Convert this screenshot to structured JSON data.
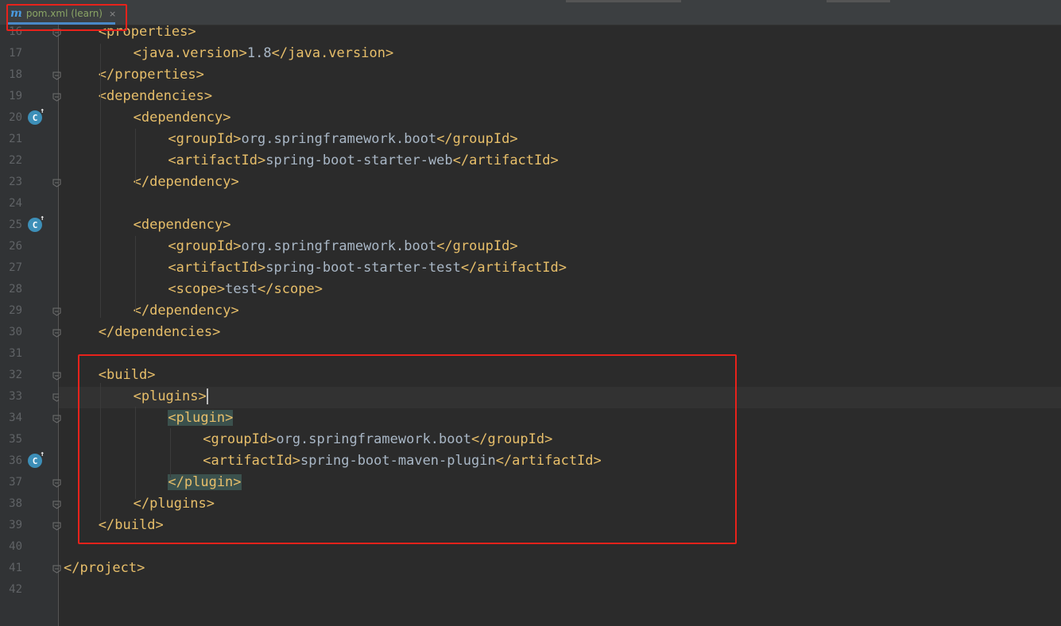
{
  "tab": {
    "icon": "maven-icon",
    "label": "pom.xml (learn)",
    "close_glyph": "×"
  },
  "lines": [
    {
      "n": "16",
      "indent": 1,
      "open": true,
      "tag": "properties"
    },
    {
      "n": "17",
      "indent": 2,
      "open": true,
      "tag": "java.version",
      "text": "1.8",
      "close": "java.version"
    },
    {
      "n": "18",
      "indent": 1,
      "open": false,
      "tag": "properties"
    },
    {
      "n": "19",
      "indent": 1,
      "open": true,
      "tag": "dependencies"
    },
    {
      "n": "20",
      "indent": 2,
      "open": true,
      "tag": "dependency"
    },
    {
      "n": "21",
      "indent": 3,
      "open": true,
      "tag": "groupId",
      "text": "org.springframework.boot",
      "close": "groupId"
    },
    {
      "n": "22",
      "indent": 3,
      "open": true,
      "tag": "artifactId",
      "text": "spring-boot-starter-web",
      "close": "artifactId"
    },
    {
      "n": "23",
      "indent": 2,
      "open": false,
      "tag": "dependency"
    },
    {
      "n": "24",
      "indent": 0,
      "empty": true
    },
    {
      "n": "25",
      "indent": 2,
      "open": true,
      "tag": "dependency"
    },
    {
      "n": "26",
      "indent": 3,
      "open": true,
      "tag": "groupId",
      "text": "org.springframework.boot",
      "close": "groupId"
    },
    {
      "n": "27",
      "indent": 3,
      "open": true,
      "tag": "artifactId",
      "text": "spring-boot-starter-test",
      "close": "artifactId"
    },
    {
      "n": "28",
      "indent": 3,
      "open": true,
      "tag": "scope",
      "text": "test",
      "close": "scope"
    },
    {
      "n": "29",
      "indent": 2,
      "open": false,
      "tag": "dependency"
    },
    {
      "n": "30",
      "indent": 1,
      "open": false,
      "tag": "dependencies"
    },
    {
      "n": "31",
      "indent": 0,
      "empty": true
    },
    {
      "n": "32",
      "indent": 1,
      "open": true,
      "tag": "build"
    },
    {
      "n": "33",
      "indent": 2,
      "open": true,
      "tag": "plugins",
      "caret": true
    },
    {
      "n": "34",
      "indent": 3,
      "open": true,
      "tag": "plugin",
      "highlight": true
    },
    {
      "n": "35",
      "indent": 4,
      "open": true,
      "tag": "groupId",
      "text": "org.springframework.boot",
      "close": "groupId"
    },
    {
      "n": "36",
      "indent": 4,
      "open": true,
      "tag": "artifactId",
      "text": "spring-boot-maven-plugin",
      "close": "artifactId"
    },
    {
      "n": "37",
      "indent": 3,
      "open": false,
      "tag": "plugin",
      "highlight": true
    },
    {
      "n": "38",
      "indent": 2,
      "open": false,
      "tag": "plugins"
    },
    {
      "n": "39",
      "indent": 1,
      "open": false,
      "tag": "build"
    },
    {
      "n": "40",
      "indent": 0,
      "empty": true
    },
    {
      "n": "41",
      "indent": 0,
      "open": false,
      "tag": "project"
    },
    {
      "n": "42",
      "indent": 0,
      "empty": true
    }
  ],
  "gutter_run_icons": [
    "20",
    "25",
    "36"
  ],
  "fold_markers": [
    "16",
    "18",
    "19",
    "23",
    "29",
    "30",
    "32",
    "33",
    "34",
    "37",
    "38",
    "39",
    "41"
  ],
  "colors": {
    "bg": "#2b2b2b",
    "tag": "#e8bf6a",
    "text": "#a9b7c6",
    "annotation_box": "#e8221b",
    "line_number": "#606366"
  }
}
